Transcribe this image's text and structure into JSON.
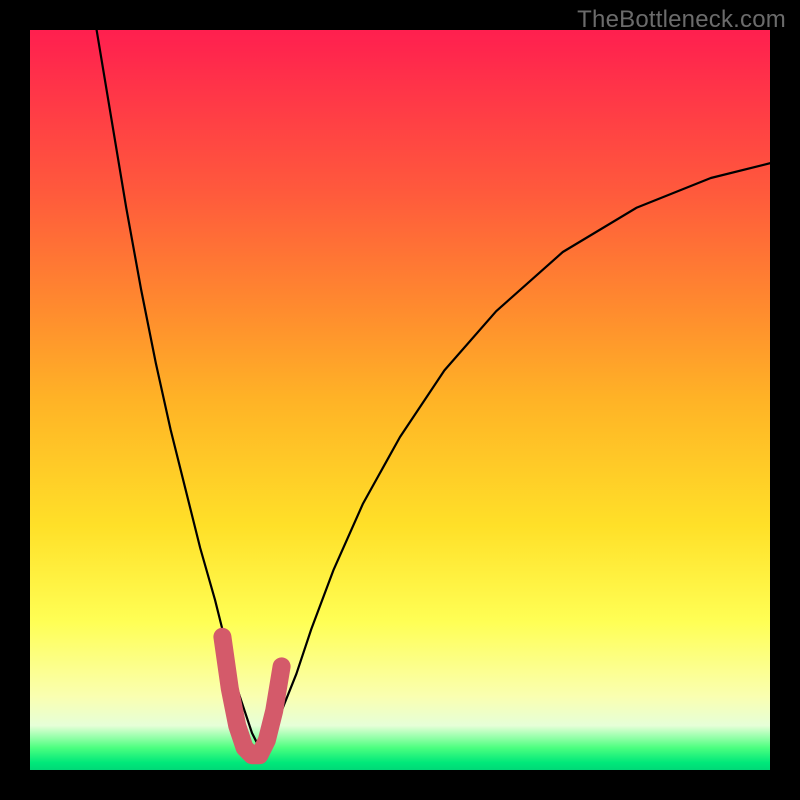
{
  "watermark": "TheBottleneck.com",
  "chart_data": {
    "type": "line",
    "title": "",
    "xlabel": "",
    "ylabel": "",
    "xlim": [
      0,
      100
    ],
    "ylim": [
      0,
      100
    ],
    "note": "V-shaped bottleneck curve on rainbow gradient; sweet spot highlighted in pink near x≈26–34%",
    "series": [
      {
        "name": "bottleneck-curve",
        "x": [
          9,
          11,
          13,
          15,
          17,
          19,
          21,
          23,
          25,
          27,
          28,
          29,
          30,
          31,
          32,
          33,
          34,
          36,
          38,
          41,
          45,
          50,
          56,
          63,
          72,
          82,
          92,
          100
        ],
        "y": [
          100,
          88,
          76,
          65,
          55,
          46,
          38,
          30,
          23,
          15,
          11,
          8,
          5,
          3,
          3,
          5,
          8,
          13,
          19,
          27,
          36,
          45,
          54,
          62,
          70,
          76,
          80,
          82
        ]
      },
      {
        "name": "sweet-spot-highlight",
        "x": [
          26,
          27,
          28,
          29,
          30,
          31,
          32,
          33,
          34
        ],
        "y": [
          18,
          11,
          6,
          3,
          2,
          2,
          4,
          8,
          14
        ]
      }
    ],
    "gradient_stops": [
      {
        "pos": 0,
        "color": "#ff1f4f"
      },
      {
        "pos": 22,
        "color": "#ff5a3c"
      },
      {
        "pos": 38,
        "color": "#ff8c2e"
      },
      {
        "pos": 50,
        "color": "#ffb326"
      },
      {
        "pos": 67,
        "color": "#ffe028"
      },
      {
        "pos": 80,
        "color": "#ffff55"
      },
      {
        "pos": 90,
        "color": "#faffb0"
      },
      {
        "pos": 94,
        "color": "#e6ffd8"
      },
      {
        "pos": 97,
        "color": "#4cff80"
      },
      {
        "pos": 99,
        "color": "#00e87a"
      },
      {
        "pos": 100,
        "color": "#00d877"
      }
    ]
  }
}
